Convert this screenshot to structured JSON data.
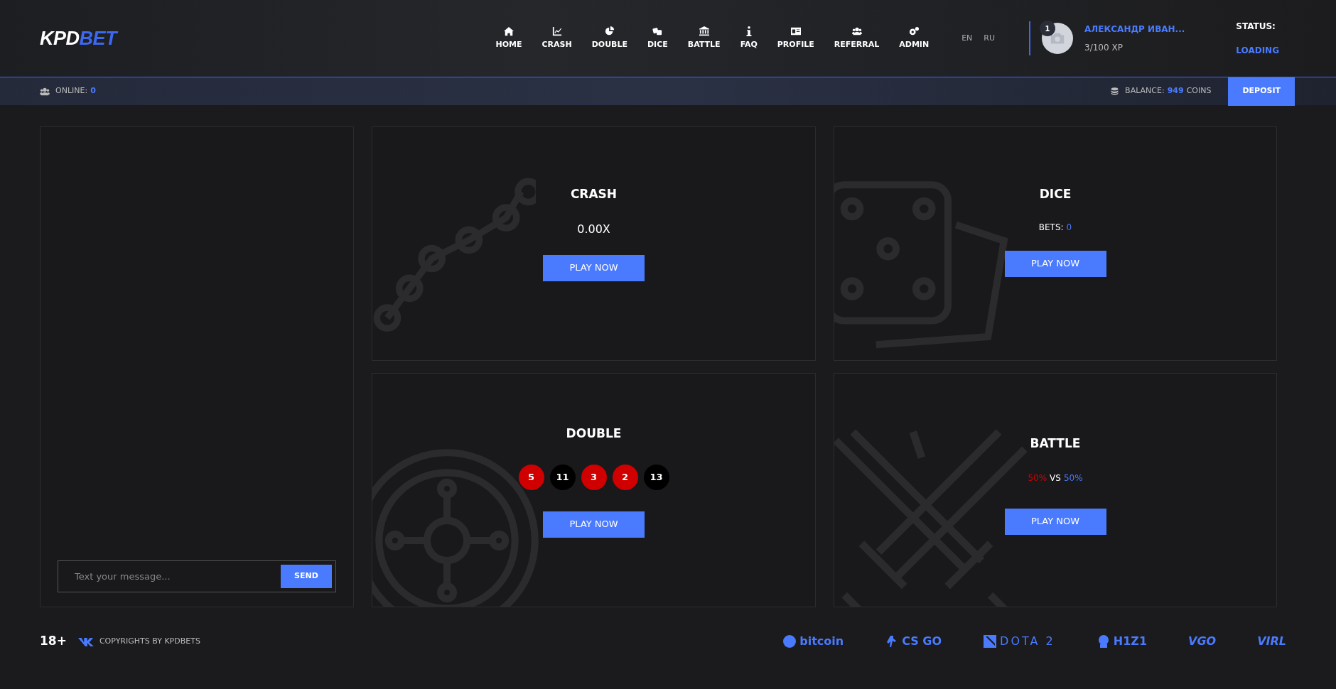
{
  "logo": {
    "left": "KPD",
    "right": "BET"
  },
  "nav": [
    {
      "label": "HOME"
    },
    {
      "label": "CRASH"
    },
    {
      "label": "DOUBLE"
    },
    {
      "label": "DICE"
    },
    {
      "label": "BATTLE"
    },
    {
      "label": "FAQ"
    },
    {
      "label": "PROFILE"
    },
    {
      "label": "REFERRAL"
    },
    {
      "label": "ADMIN"
    }
  ],
  "languages": [
    "EN",
    "RU"
  ],
  "user": {
    "level": "1",
    "name": "АЛЕКСАНДР ИВАН...",
    "xp": "3/100 XP"
  },
  "status": {
    "label": "STATUS:",
    "value": "LOADING"
  },
  "subbar": {
    "online_label": "ONLINE:",
    "online": "0",
    "balance_label": "BALANCE:",
    "balance": "949",
    "coins": "COINS",
    "deposit": "DEPOSIT"
  },
  "chat": {
    "placeholder": "Text your message...",
    "send": "SEND"
  },
  "games": [
    {
      "kind": "crash",
      "title": "CRASH",
      "value": "0.00X",
      "button": "PLAY NOW"
    },
    {
      "kind": "dice",
      "title": "DICE",
      "bets_label": "BETS:",
      "bets": "0",
      "button": "PLAY NOW"
    },
    {
      "kind": "double",
      "title": "DOUBLE",
      "history": [
        {
          "number": "5",
          "color": "#d10000"
        },
        {
          "number": "11",
          "color": "#000000"
        },
        {
          "number": "3",
          "color": "#d10000"
        },
        {
          "number": "2",
          "color": "#d10000"
        },
        {
          "number": "13",
          "color": "#000000"
        }
      ],
      "button": "PLAY NOW"
    },
    {
      "kind": "battle",
      "title": "BATTLE",
      "red": "50%",
      "vs": "VS",
      "blue": "50%",
      "button": "PLAY NOW"
    }
  ],
  "footer": {
    "age": "18+",
    "copyright": "COPYRIGHTS BY KPDBETS",
    "partners": [
      {
        "kind": "bitcoin",
        "text": "bitcoin"
      },
      {
        "kind": "csgo",
        "text": "CS GO"
      },
      {
        "kind": "dota",
        "text": "DOTA 2"
      },
      {
        "kind": "h1z1",
        "text": "H1Z1"
      },
      {
        "kind": "vgo",
        "text": "VGO"
      },
      {
        "kind": "virl",
        "text": "VIRL"
      }
    ]
  }
}
